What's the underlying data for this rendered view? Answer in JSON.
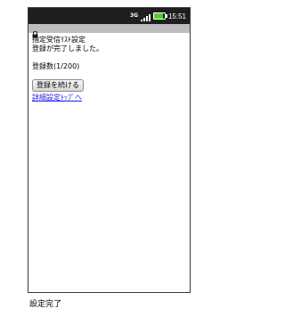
{
  "status_bar": {
    "network": "3G",
    "time": "15:51",
    "battery_level": 0.8,
    "battery_color": "#4fd130"
  },
  "page": {
    "title_line1": "指定受信ﾘｽﾄ設定",
    "title_line2": "登録が完了しました。",
    "count_text": "登録数(1/200)",
    "continue_button_label": "登録を続ける",
    "top_link_label": "詳細設定ﾄｯﾌﾟへ"
  },
  "caption": "設定完了",
  "colors": {
    "status_bar_bg": "#1e1e1e",
    "notif_bar_bg": "#bdbdbd",
    "link": "#1a1aee"
  }
}
